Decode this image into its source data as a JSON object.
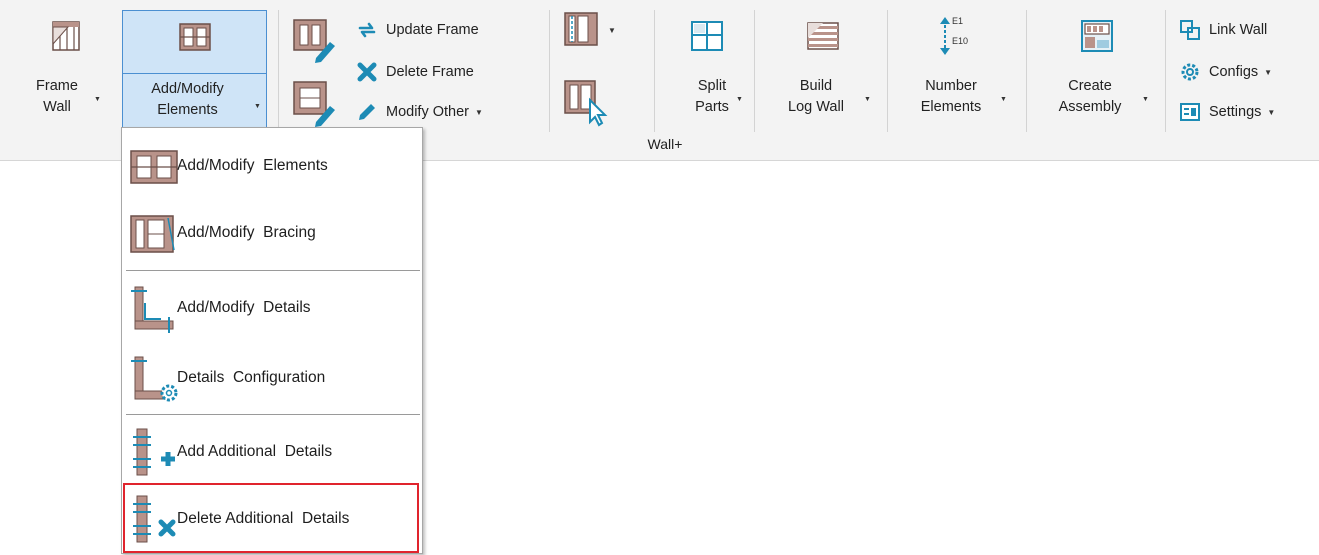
{
  "panel": {
    "title": "Wall+"
  },
  "buttons": {
    "frame_wall": "Frame\nWall",
    "add_modify": "Add/Modify\nElements",
    "update_frame": "Update Frame",
    "delete_frame": "Delete Frame",
    "modify_other": "Modify Other",
    "split_parts": "Split\nParts",
    "build_log_wall": "Build\nLog Wall",
    "number_elements": "Number\nElements",
    "number_icon_top": "E1",
    "number_icon_bottom": "E10",
    "create_assembly": "Create\nAssembly",
    "link_wall": "Link Wall",
    "configs": "Configs",
    "settings": "Settings"
  },
  "menu": {
    "items": [
      {
        "label": "Add/Modify  Elements",
        "icon": "frame-elements-icon"
      },
      {
        "label": "Add/Modify  Bracing",
        "icon": "bracing-icon"
      },
      {
        "label": "Add/Modify  Details",
        "icon": "details-icon"
      },
      {
        "label": "Details  Configuration",
        "icon": "details-config-icon"
      },
      {
        "label": "Add Additional  Details",
        "icon": "add-details-icon"
      },
      {
        "label": "Delete Additional  Details",
        "icon": "delete-details-icon"
      }
    ],
    "highlighted_index": 5
  },
  "colors": {
    "accent": "#1d8bb5",
    "wood": "#b9938a",
    "selection_bg": "#cfe4f7",
    "highlight_border": "#e0242d"
  }
}
